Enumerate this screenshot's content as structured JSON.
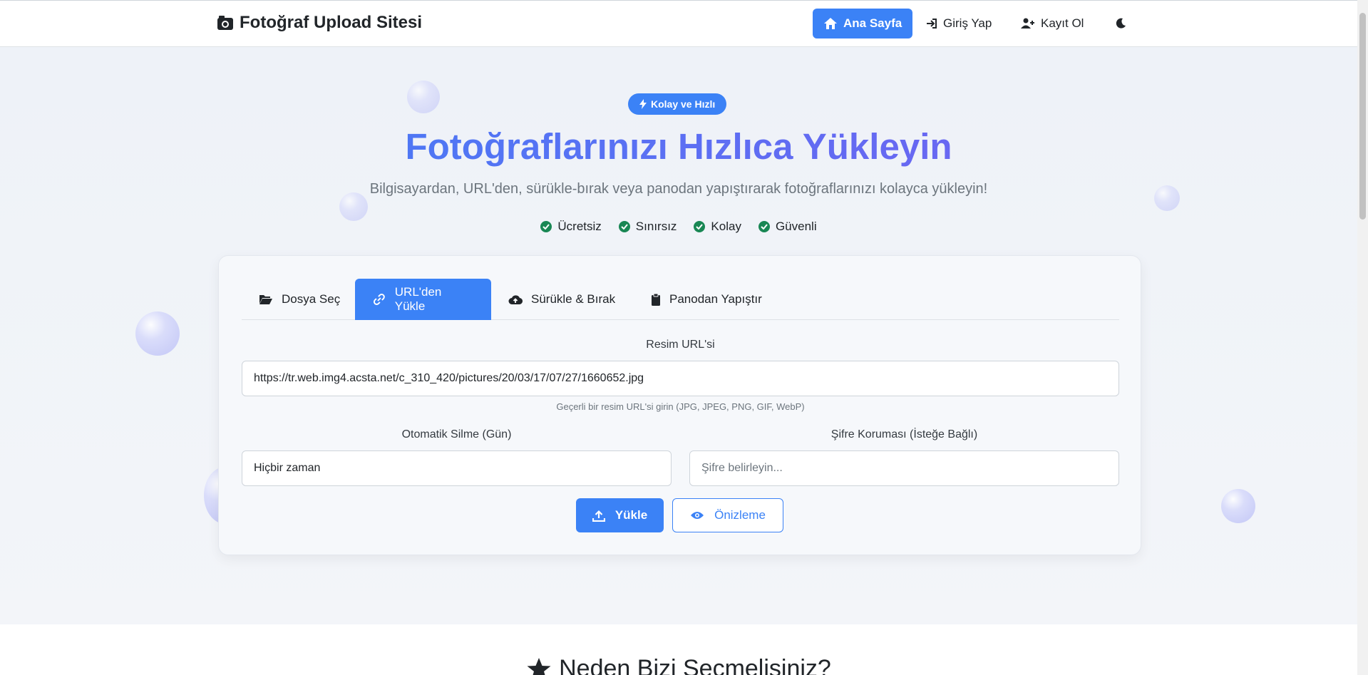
{
  "navbar": {
    "brand": "Fotoğraf Upload Sitesi",
    "items": [
      {
        "label": "Ana Sayfa",
        "icon": "home-icon",
        "active": true
      },
      {
        "label": "Giriş Yap",
        "icon": "sign-in-icon",
        "active": false
      },
      {
        "label": "Kayıt Ol",
        "icon": "user-plus-icon",
        "active": false
      }
    ],
    "theme_toggle_icon": "moon-icon"
  },
  "hero": {
    "badge": "Kolay ve Hızlı",
    "title": "Fotoğraflarınızı Hızlıca Yükleyin",
    "subtitle": "Bilgisayardan, URL'den, sürükle-bırak veya panodan yapıştırarak fotoğraflarınızı kolayca yükleyin!",
    "features": [
      "Ücretsiz",
      "Sınırsız",
      "Kolay",
      "Güvenli"
    ]
  },
  "upload_card": {
    "tabs": [
      {
        "label": "Dosya Seç",
        "icon": "folder-open-icon",
        "active": false
      },
      {
        "label": "URL'den Yükle",
        "icon": "link-icon",
        "active": true
      },
      {
        "label": "Sürükle & Bırak",
        "icon": "cloud-upload-icon",
        "active": false
      },
      {
        "label": "Panodan Yapıştır",
        "icon": "clipboard-icon",
        "active": false
      }
    ],
    "url_label": "Resim URL'si",
    "url_value": "https://tr.web.img4.acsta.net/c_310_420/pictures/20/03/17/07/27/1660652.jpg",
    "url_help": "Geçerli bir resim URL'si girin (JPG, JPEG, PNG, GIF, WebP)",
    "auto_delete_label": "Otomatik Silme (Gün)",
    "auto_delete_value": "Hiçbir zaman",
    "password_label": "Şifre Koruması (İsteğe Bağlı)",
    "password_placeholder": "Şifre belirleyin...",
    "upload_button": "Yükle",
    "preview_button": "Önizleme"
  },
  "section": {
    "title": "Neden Bizi Seçmelisiniz?"
  },
  "colors": {
    "accent": "#3b82f6",
    "title_gradient_end": "#7c5cf0",
    "success": "#198754"
  }
}
